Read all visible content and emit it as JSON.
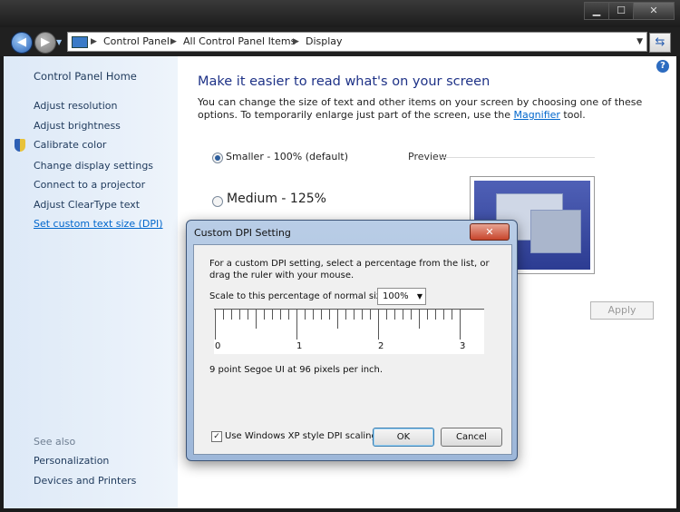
{
  "window": {
    "caption": {
      "minimize": "▁",
      "maximize": "☐",
      "close": "✕"
    }
  },
  "address_bar": {
    "crumbs": [
      "Control Panel",
      "All Control Panel Items",
      "Display"
    ]
  },
  "sidebar": {
    "home": "Control Panel Home",
    "items": [
      "Adjust resolution",
      "Adjust brightness",
      "Calibrate color",
      "Change display settings",
      "Connect to a projector",
      "Adjust ClearType text",
      "Set custom text size (DPI)"
    ],
    "see_also_heading": "See also",
    "see_also": [
      "Personalization",
      "Devices and Printers"
    ]
  },
  "main": {
    "help": "?",
    "heading": "Make it easier to read what's on your screen",
    "description_before": "You can change the size of text and other items on your screen by choosing one of these options. To temporarily enlarge just part of the screen, use the ",
    "description_link": "Magnifier",
    "description_after": " tool.",
    "options": [
      {
        "label": "Smaller - 100% (default)",
        "selected": true
      },
      {
        "label": "Medium - 125%",
        "selected": false
      }
    ],
    "preview_label": "Preview",
    "apply_label": "Apply"
  },
  "dialog": {
    "title": "Custom DPI Setting",
    "close": "✕",
    "instructions": "For a custom DPI setting, select a percentage from the list, or drag the ruler with your mouse.",
    "scale_label": "Scale to this percentage of normal size:",
    "scale_value": "100%",
    "ruler_labels": [
      "0",
      "1",
      "2",
      "3"
    ],
    "dpi_info": "9 point Segoe UI at 96 pixels per inch.",
    "xp_scaling_label": "Use Windows XP style DPI scaling",
    "xp_scaling_checked": true,
    "ok_label": "OK",
    "cancel_label": "Cancel"
  }
}
